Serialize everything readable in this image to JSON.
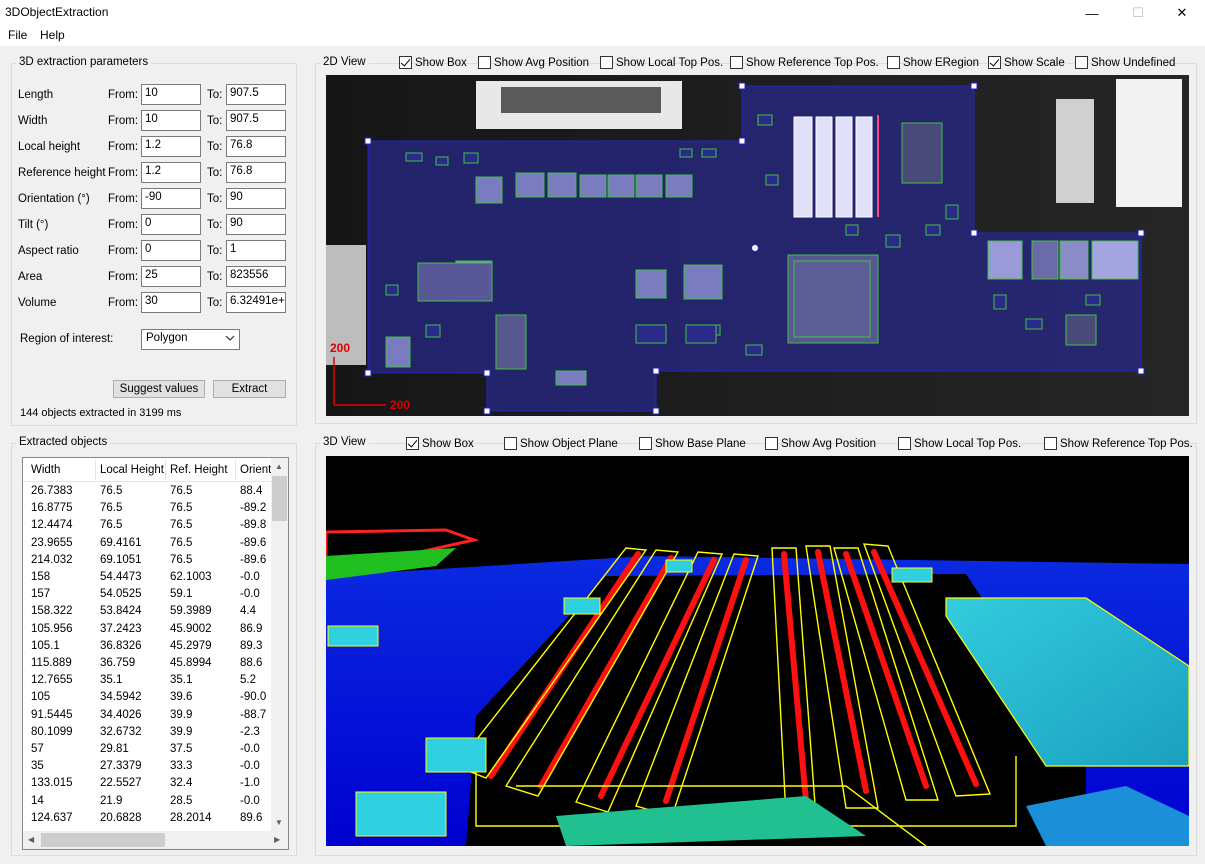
{
  "window": {
    "title": "3DObjectExtraction"
  },
  "menu": {
    "file": "File",
    "help": "Help"
  },
  "params": {
    "title": "3D extraction parameters",
    "from_label": "From:",
    "to_label": "To:",
    "rows": [
      {
        "label": "Length",
        "from": "10",
        "to": "907.5"
      },
      {
        "label": "Width",
        "from": "10",
        "to": "907.5"
      },
      {
        "label": "Local height",
        "from": "1.2",
        "to": "76.8"
      },
      {
        "label": "Reference height",
        "from": "1.2",
        "to": "76.8"
      },
      {
        "label": "Orientation (°)",
        "from": "-90",
        "to": "90"
      },
      {
        "label": "Tilt (°)",
        "from": "0",
        "to": "90"
      },
      {
        "label": "Aspect ratio",
        "from": "0",
        "to": "1"
      },
      {
        "label": "Area",
        "from": "25",
        "to": "823556"
      },
      {
        "label": "Volume",
        "from": "30",
        "to": "6.32491e+"
      }
    ],
    "roi_label": "Region of interest:",
    "roi_value": "Polygon",
    "suggest_button": "Suggest values",
    "extract_button": "Extract",
    "status": "144 objects extracted in 3199 ms"
  },
  "extracted": {
    "title": "Extracted objects",
    "columns": [
      "Width",
      "Local Height",
      "Ref. Height",
      "Orient"
    ],
    "rows": [
      [
        "26.7383",
        "76.5",
        "76.5",
        "88.4"
      ],
      [
        "16.8775",
        "76.5",
        "76.5",
        "-89.2"
      ],
      [
        "12.4474",
        "76.5",
        "76.5",
        "-89.8"
      ],
      [
        "23.9655",
        "69.4161",
        "76.5",
        "-89.6"
      ],
      [
        "214.032",
        "69.1051",
        "76.5",
        "-89.6"
      ],
      [
        "158",
        "54.4473",
        "62.1003",
        "-0.0"
      ],
      [
        "157",
        "54.0525",
        "59.1",
        "-0.0"
      ],
      [
        "158.322",
        "53.8424",
        "59.3989",
        "4.4"
      ],
      [
        "105.956",
        "37.2423",
        "45.9002",
        "86.9"
      ],
      [
        "105.1",
        "36.8326",
        "45.2979",
        "89.3"
      ],
      [
        "115.889",
        "36.759",
        "45.8994",
        "88.6"
      ],
      [
        "12.7655",
        "35.1",
        "35.1",
        "5.2"
      ],
      [
        "105",
        "34.5942",
        "39.6",
        "-90.0"
      ],
      [
        "91.5445",
        "34.4026",
        "39.9",
        "-88.7"
      ],
      [
        "80.1099",
        "32.6732",
        "39.9",
        "-2.3"
      ],
      [
        "57",
        "29.81",
        "37.5",
        "-0.0"
      ],
      [
        "35",
        "27.3379",
        "33.3",
        "-0.0"
      ],
      [
        "133.015",
        "22.5527",
        "32.4",
        "-1.0"
      ],
      [
        "14",
        "21.9",
        "28.5",
        "-0.0"
      ],
      [
        "124.637",
        "20.6828",
        "28.2014",
        "89.6"
      ]
    ]
  },
  "view2d": {
    "title": "2D View",
    "checkboxes": [
      {
        "label": "Show Box",
        "checked": true
      },
      {
        "label": "Show Avg Position",
        "checked": false
      },
      {
        "label": "Show Local Top Pos.",
        "checked": false
      },
      {
        "label": "Show Reference Top Pos.",
        "checked": false
      },
      {
        "label": "Show ERegion",
        "checked": false
      },
      {
        "label": "Show Scale",
        "checked": true
      },
      {
        "label": "Show Undefined",
        "checked": false
      }
    ],
    "scale_x": "200",
    "scale_y": "200"
  },
  "view3d": {
    "title": "3D View",
    "checkboxes": [
      {
        "label": "Show Box",
        "checked": true
      },
      {
        "label": "Show Object Plane",
        "checked": false
      },
      {
        "label": "Show Base Plane",
        "checked": false
      },
      {
        "label": "Show Avg Position",
        "checked": false
      },
      {
        "label": "Show Local Top Pos.",
        "checked": false
      },
      {
        "label": "Show Reference Top Pos.",
        "checked": false
      }
    ]
  }
}
